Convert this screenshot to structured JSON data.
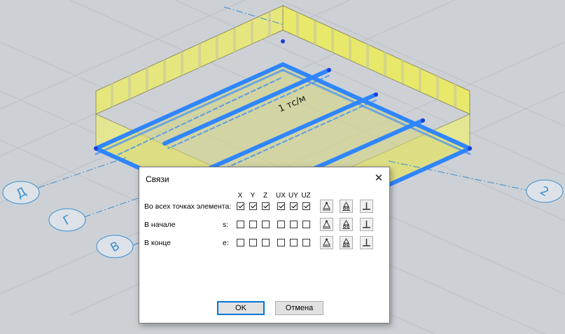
{
  "viewport": {
    "load_label": "1 тс/м",
    "axis_labels": [
      "Д",
      "Г",
      "В",
      "2"
    ]
  },
  "dialog": {
    "title": "Связи",
    "close_glyph": "✕",
    "columns": [
      "X",
      "Y",
      "Z",
      "UX",
      "UY",
      "UZ"
    ],
    "rows": [
      {
        "label": "Во всех точках элемента:",
        "prefix": "",
        "checked": [
          true,
          true,
          true,
          true,
          true,
          true
        ]
      },
      {
        "label": "В начале",
        "prefix": "s:",
        "checked": [
          false,
          false,
          false,
          false,
          false,
          false
        ]
      },
      {
        "label": "В конце",
        "prefix": "e:",
        "checked": [
          false,
          false,
          false,
          false,
          false,
          false
        ]
      }
    ],
    "row_tools": [
      "hinge-support-icon",
      "roller-support-icon",
      "fixed-support-icon"
    ],
    "ok_label": "OK",
    "cancel_label": "Отмена"
  },
  "colors": {
    "background": "#cdd1d6",
    "wall_fill": "#e8e86a",
    "beam_blue": "#2f86ff",
    "axis_line": "#3a8fd0"
  }
}
